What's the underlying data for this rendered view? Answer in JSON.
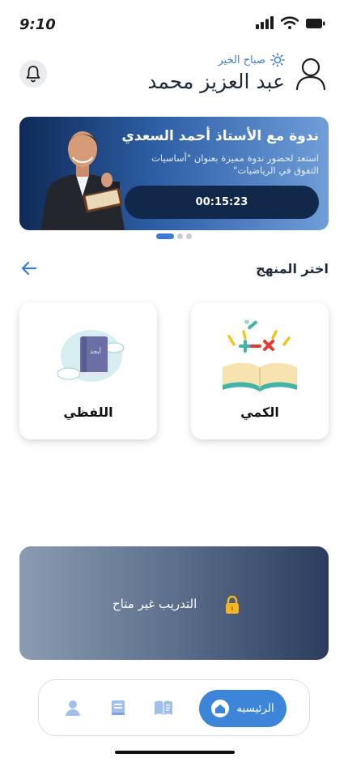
{
  "status_bar": {
    "time": "9:10",
    "icons": [
      "signal-icon",
      "wifi-icon",
      "battery-icon"
    ]
  },
  "header": {
    "greeting": "صباح الخير",
    "greeting_icon": "sun-icon",
    "user_name": "عبد العزيز محمد",
    "notification_icon": "bell-icon",
    "profile_icon": "user-icon"
  },
  "banner": {
    "title": "ندوة مع الأستاذ أحمد السعدي",
    "description": "استعد لحضور ندوة مميزة بعنوان \"أساسيات التفوق في الرياضيات\"",
    "countdown": "00:15:23",
    "pager": {
      "count": 3,
      "active": 0
    }
  },
  "curriculum": {
    "title": "اختر المنهج",
    "back_icon": "arrow-left-icon",
    "cards": [
      {
        "label": "الكمي",
        "icon": "math-book-icon"
      },
      {
        "label": "اللفظي",
        "icon": "arabic-book-icon"
      }
    ]
  },
  "training": {
    "text": "التدريب غير متاح",
    "icon": "lock-icon"
  },
  "bottom_nav": {
    "items": [
      {
        "label": "الرئيسيه",
        "icon": "home-icon",
        "active": true
      },
      {
        "label": "",
        "icon": "open-book-icon",
        "active": false
      },
      {
        "label": "",
        "icon": "book-icon",
        "active": false
      },
      {
        "label": "",
        "icon": "profile-icon",
        "active": false
      }
    ]
  },
  "colors": {
    "accent": "#3d85d8",
    "banner_dark": "#0f2a57",
    "timer_bg": "#12284a",
    "locked_dark": "#2c3c5e",
    "nav_inactive": "#9fc0ea"
  }
}
